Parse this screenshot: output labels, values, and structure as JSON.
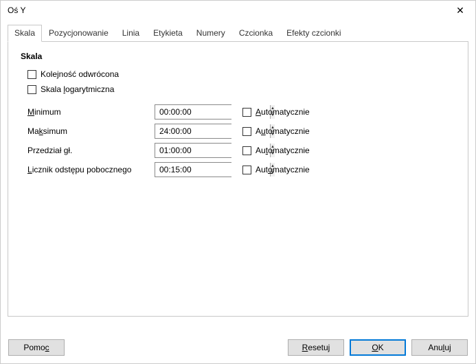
{
  "window": {
    "title": "Oś Y"
  },
  "tabs": {
    "t0": "Skala",
    "t1": "Pozycjonowanie",
    "t2": "Linia",
    "t3": "Etykieta",
    "t4": "Numery",
    "t5": "Czcionka",
    "t6": "Efekty czcionki"
  },
  "section": {
    "title": "Skala",
    "reverse": "Kolejność odwrócona",
    "log_pre": "Skala ",
    "log_u": "l",
    "log_post": "ogarytmiczna"
  },
  "rows": {
    "min": {
      "label_u": "M",
      "label_post": "inimum",
      "value": "00:00:00"
    },
    "max": {
      "label_pre": "Ma",
      "label_u": "k",
      "label_post": "simum",
      "value": "24:00:00"
    },
    "major": {
      "label_pre": "Przedział ",
      "label_u": "g",
      "label_post": "ł.",
      "value": "01:00:00"
    },
    "minor": {
      "label_u": "L",
      "label_post": "icznik odstępu pobocznego",
      "value": "00:15:00"
    }
  },
  "auto": {
    "a1_u": "A",
    "a1_post": "utomatycznie",
    "a2_pre": "A",
    "a2_u": "u",
    "a2_post": "tomatycznie",
    "a3_pre": "Au",
    "a3_u": "t",
    "a3_post": "omatycznie",
    "a4_pre": "Aut",
    "a4_u": "o",
    "a4_post": "matycznie"
  },
  "buttons": {
    "help_pre": "Pomo",
    "help_u": "c",
    "reset_u": "R",
    "reset_post": "esetuj",
    "ok_u": "O",
    "ok_post": "K",
    "cancel_pre": "Anu",
    "cancel_u": "l",
    "cancel_post": "uj"
  }
}
